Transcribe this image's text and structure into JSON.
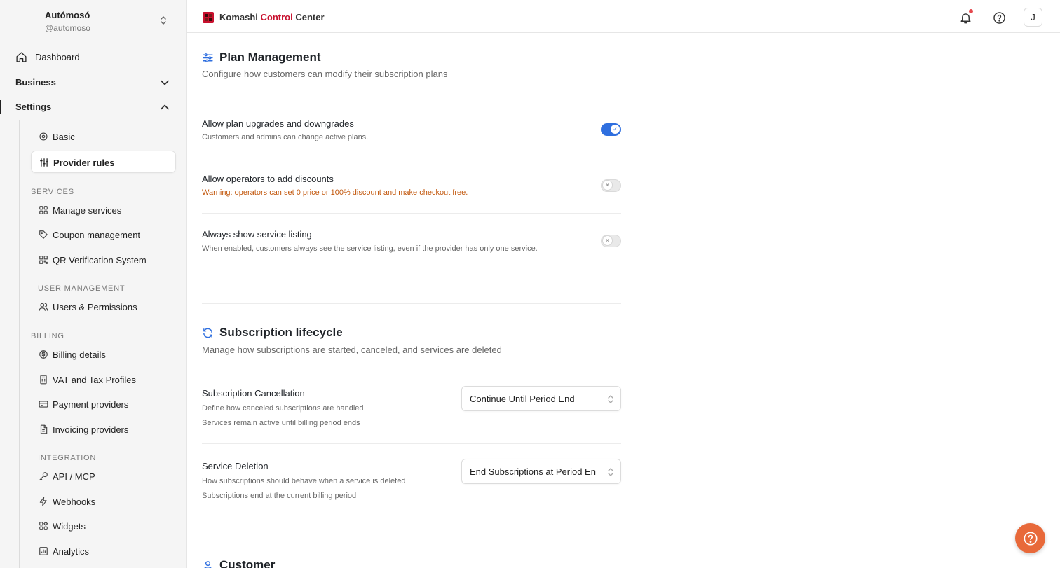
{
  "org": {
    "name": "Autómosó",
    "handle": "@automoso"
  },
  "nav": {
    "dashboard": "Dashboard",
    "business": "Business",
    "settings": "Settings",
    "basic": "Basic",
    "provider_rules": "Provider rules",
    "services_label": "SERVICES",
    "manage_services": "Manage services",
    "coupon_management": "Coupon management",
    "qr_verification": "QR Verification System",
    "user_mgmt_label": "USER MANAGEMENT",
    "users_permissions": "Users & Permissions",
    "billing_label": "BILLING",
    "billing_details": "Billing details",
    "vat_tax": "VAT and Tax Profiles",
    "payment_providers": "Payment providers",
    "invoicing_providers": "Invoicing providers",
    "integration_label": "INTEGRATION",
    "api_mcp": "API / MCP",
    "webhooks": "Webhooks",
    "widgets": "Widgets",
    "analytics": "Analytics"
  },
  "header": {
    "brand_part1": "Komashi ",
    "brand_part2": "Control",
    "brand_part3": " Center",
    "avatar_initial": "J",
    "brand_accent": "#c8102e"
  },
  "plan": {
    "title": "Plan Management",
    "desc": "Configure how customers can modify their subscription plans",
    "rows": [
      {
        "title": "Allow plan upgrades and downgrades",
        "desc": "Customers and admins can change active plans.",
        "enabled": true
      },
      {
        "title": "Allow operators to add discounts",
        "desc": "Warning: operators can set 0 price or 100% discount and make checkout free.",
        "enabled": false
      },
      {
        "title": "Always show service listing",
        "desc": "When enabled, customers always see the service listing, even if the provider has only one service.",
        "enabled": false
      }
    ]
  },
  "lifecycle": {
    "title": "Subscription lifecycle",
    "desc": "Manage how subscriptions are started, canceled, and services are deleted",
    "cancellation": {
      "title": "Subscription Cancellation",
      "desc": "Define how canceled subscriptions are handled",
      "note": "Services remain active until billing period ends",
      "value": "Continue Until Period End"
    },
    "deletion": {
      "title": "Service Deletion",
      "desc": "How subscriptions should behave when a service is deleted",
      "note": "Subscriptions end at the current billing period",
      "value": "End Subscriptions at Period End"
    }
  },
  "customer": {
    "title": "Customer"
  },
  "colors": {
    "accent": "#2f6fdf",
    "warning": "#c2570c",
    "fab": "#e8693a"
  }
}
